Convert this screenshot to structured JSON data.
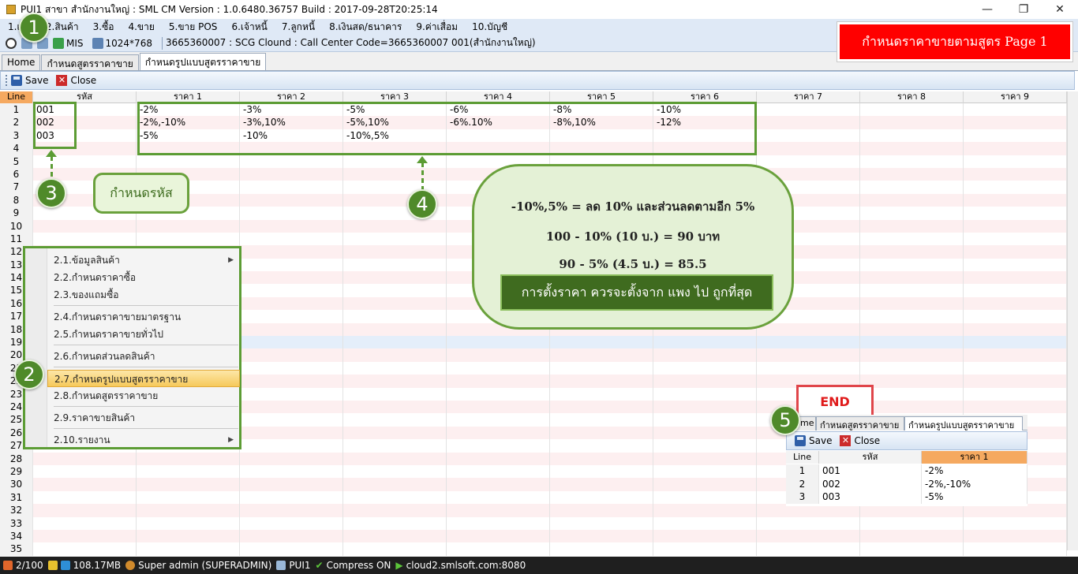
{
  "window": {
    "title": "PUI1 สาขา สำนักงานใหญ่ : SML CM Version : 1.0.6480.36757  Build : 2017-09-28T20:25:14",
    "minimize": "—",
    "maximize": "❐",
    "close": "✕"
  },
  "menu": [
    "1.เริ่ม",
    "2.สินค้า",
    "3.ซื้อ",
    "4.ขาย",
    "5.ขาย POS",
    "6.เจ้าหนี้",
    "7.ลูกหนี้",
    "8.เงินสด/ธนาคาร",
    "9.ค่าเสื่อม",
    "10.บัญชี"
  ],
  "infobar": {
    "mis": "MIS",
    "resolution": "1024*768",
    "connection": "3665360007 : SCG Clound : Call Center Code=3665360007 001(สำนักงานใหญ่)"
  },
  "tabs": [
    "Home",
    "กำหนดสูตรราคาขาย",
    "กำหนดรูปแบบสูตรราคาขาย"
  ],
  "toolbar": {
    "save": "Save",
    "close": "Close"
  },
  "grid": {
    "headers": [
      "Line",
      "รหัส",
      "ราคา 1",
      "ราคา 2",
      "ราคา 3",
      "ราคา 4",
      "ราคา 5",
      "ราคา 6",
      "ราคา 7",
      "ราคา 8",
      "ราคา 9"
    ],
    "rows": [
      [
        "001",
        "-2%",
        "-3%",
        "-5%",
        "-6%",
        "-8%",
        "-10%"
      ],
      [
        "002",
        "-2%,-10%",
        "-3%,10%",
        "-5%,10%",
        "-6%.10%",
        "-8%,10%",
        "-12%"
      ],
      [
        "003",
        "-5%",
        "-10%",
        "-10%,5%",
        "",
        "",
        ""
      ]
    ],
    "line_count": 35
  },
  "annotations": {
    "banner": "กำหนดราคาขายตามสูตร   Page 1",
    "step1": "1",
    "step2": "2",
    "step3": "3",
    "step4": "4",
    "step5": "5",
    "callout3": "กำหนดรหัส",
    "bubble4": {
      "line1": "-10%,5% = ลด 10%  และส่วนลดตามอีก 5%",
      "line2": "100 - 10% (10 บ.) = 90 บาท",
      "line3": "90 - 5% (4.5 บ.) =  85.5",
      "band": "การตั้งราคา ควรจะตั้งจาก  แพง ไป ถูกที่สุด"
    },
    "end": "END"
  },
  "context_menu": [
    {
      "label": "2.1.ข้อมูลสินค้า",
      "submenu": true
    },
    {
      "label": "2.2.กำหนดราคาซื้อ",
      "submenu": false
    },
    {
      "label": "2.3.ของแถมซื้อ",
      "submenu": false
    },
    {
      "label": "2.4.กำหนดราคาขายมาตรฐาน",
      "submenu": false
    },
    {
      "label": "2.5.กำหนดราคาขายทั่วไป",
      "submenu": false
    },
    {
      "label": "2.6.กำหนดส่วนลดสินค้า",
      "submenu": false
    },
    {
      "label": "2.7.กำหนดรูปแบบสูตรราคาขาย",
      "submenu": false,
      "selected": true
    },
    {
      "label": "2.8.กำหนดสูตรราคาขาย",
      "submenu": false
    },
    {
      "label": "2.9.ราคาขายสินค้า",
      "submenu": false
    },
    {
      "label": "2.10.รายงาน",
      "submenu": true
    }
  ],
  "inset": {
    "tabs": [
      "Home",
      "กำหนดสูตรราคาขาย",
      "กำหนดรูปแบบสูตรราคาขาย"
    ],
    "save": "Save",
    "close": "Close",
    "headers": [
      "Line",
      "รหัส",
      "ราคา 1"
    ],
    "rows": [
      [
        "1",
        "001",
        "-2%"
      ],
      [
        "2",
        "002",
        "-2%,-10%"
      ],
      [
        "3",
        "003",
        "-5%"
      ]
    ]
  },
  "status": {
    "pages": "2/100",
    "memory": "108.17MB",
    "user": "Super admin (SUPERADMIN)",
    "branch": "PUI1",
    "compress": "Compress ON",
    "server": "cloud2.smlsoft.com:8080"
  },
  "colors": {
    "annotation_green": "#5c9c34",
    "banner_red": "#ff0000",
    "header_orange": "#f5a960",
    "menu_blue": "#dfe9f6"
  }
}
